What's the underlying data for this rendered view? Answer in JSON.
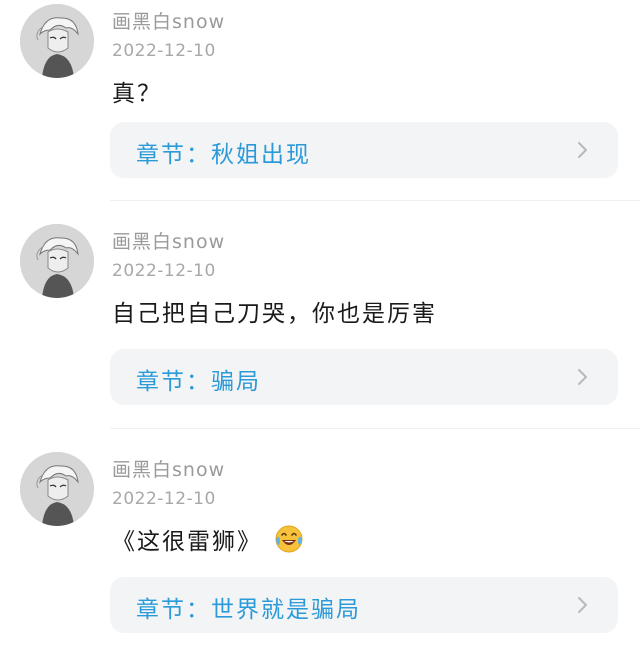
{
  "comments": [
    {
      "username": "画黑白snow",
      "date": "2022-12-10",
      "text": "真？",
      "emoji": "",
      "chapter_label": "章节：",
      "chapter_title": "秋姐出现",
      "avatar_icon": "anime-character-avatar",
      "chevron_icon": "chevron-right-icon"
    },
    {
      "username": "画黑白snow",
      "date": "2022-12-10",
      "text": "自己把自己刀哭，你也是厉害",
      "emoji": "",
      "chapter_label": "章节：",
      "chapter_title": "骗局",
      "avatar_icon": "anime-character-avatar",
      "chevron_icon": "chevron-right-icon"
    },
    {
      "username": "画黑白snow",
      "date": "2022-12-10",
      "text": "《这很雷狮》",
      "emoji": "laughing-with-tears-emoji",
      "chapter_label": "章节：",
      "chapter_title": "世界就是骗局",
      "avatar_icon": "anime-character-avatar",
      "chevron_icon": "chevron-right-icon"
    }
  ],
  "colors": {
    "username": "#9a9a9a",
    "date": "#a8a8a8",
    "text": "#1a1a1a",
    "chapter_link": "#2b9ad8",
    "chapter_bg": "#f3f4f6"
  }
}
